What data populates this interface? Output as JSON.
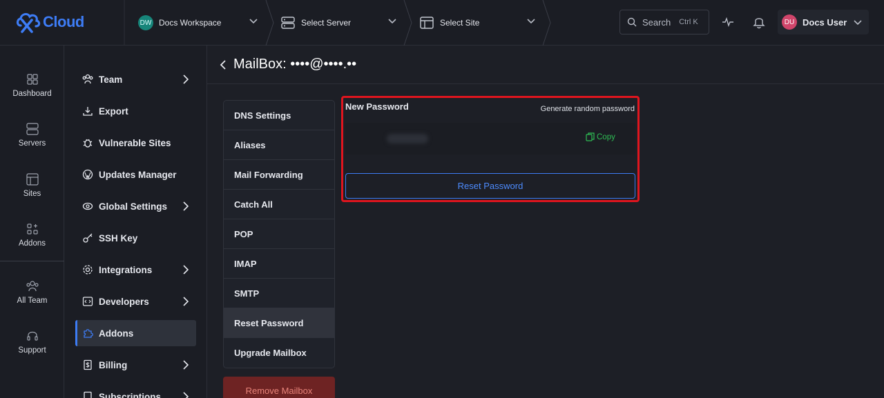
{
  "brand": {
    "name": "Cloud",
    "accent": "#3d7cf5"
  },
  "topbar": {
    "workspace": {
      "initials": "DW",
      "label": "Docs Workspace"
    },
    "server": {
      "label": "Select Server",
      "icon": "server-icon"
    },
    "site": {
      "label": "Select Site",
      "icon": "site-icon"
    },
    "search": {
      "label": "Search",
      "shortcut": "Ctrl K"
    },
    "user": {
      "initials": "DU",
      "name": "Docs User"
    }
  },
  "rail": {
    "items": [
      {
        "label": "Dashboard",
        "icon": "dashboard-icon"
      },
      {
        "label": "Servers",
        "icon": "servers-icon"
      },
      {
        "label": "Sites",
        "icon": "sites-icon"
      },
      {
        "label": "Addons",
        "icon": "addons-icon"
      },
      {
        "label": "All Team",
        "icon": "team-icon"
      },
      {
        "label": "Support",
        "icon": "headset-icon"
      }
    ]
  },
  "menu": {
    "items": [
      {
        "label": "Team",
        "icon": "team-icon",
        "has_arrow": true
      },
      {
        "label": "Export",
        "icon": "export-icon",
        "has_arrow": false
      },
      {
        "label": "Vulnerable Sites",
        "icon": "bug-icon",
        "has_arrow": false
      },
      {
        "label": "Updates Manager",
        "icon": "wordpress-icon",
        "has_arrow": false
      },
      {
        "label": "Global Settings",
        "icon": "globe-icon",
        "has_arrow": true
      },
      {
        "label": "SSH Key",
        "icon": "key-icon",
        "has_arrow": false
      },
      {
        "label": "Integrations",
        "icon": "gear-icon",
        "has_arrow": true
      },
      {
        "label": "Developers",
        "icon": "code-icon",
        "has_arrow": true
      },
      {
        "label": "Addons",
        "icon": "puzzle-icon",
        "has_arrow": false,
        "active": true
      },
      {
        "label": "Billing",
        "icon": "billing-icon",
        "has_arrow": true
      },
      {
        "label": "Subscriptions",
        "icon": "subscriptions-icon",
        "has_arrow": true
      }
    ]
  },
  "page": {
    "title": "MailBox: ••••@••••.••"
  },
  "submenu": {
    "items": [
      "DNS Settings",
      "Aliases",
      "Mail Forwarding",
      "Catch All",
      "POP",
      "IMAP",
      "SMTP",
      "Reset Password",
      "Upgrade Mailbox"
    ],
    "active": "Reset Password",
    "remove_label": "Remove Mailbox"
  },
  "reset_panel": {
    "label": "New Password",
    "generate_link": "Generate random password",
    "copy_label": "Copy",
    "button_label": "Reset Password",
    "highlight_color": "#e0151e"
  }
}
